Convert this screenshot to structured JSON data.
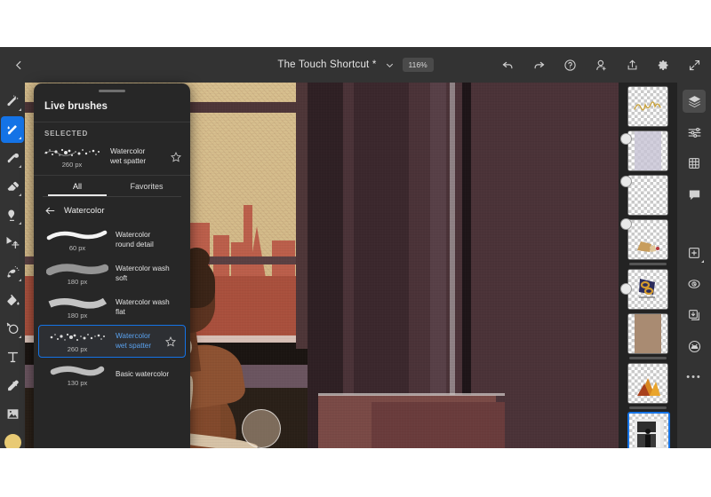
{
  "topbar": {
    "back_icon": "chevron-left-icon",
    "title": "The Touch Shortcut *",
    "title_chevron": "chevron-down-icon",
    "zoom": "116%",
    "actions": [
      {
        "name": "undo-button",
        "icon": "undo-icon"
      },
      {
        "name": "redo-button",
        "icon": "redo-icon"
      },
      {
        "name": "help-button",
        "icon": "question-circle-icon"
      },
      {
        "name": "invite-button",
        "icon": "add-person-icon"
      },
      {
        "name": "share-button",
        "icon": "share-upload-icon"
      },
      {
        "name": "settings-button",
        "icon": "gear-icon"
      },
      {
        "name": "fullscreen-button",
        "icon": "expand-arrows-icon"
      }
    ]
  },
  "left_tools": [
    {
      "name": "tool-pixel-brush",
      "icon": "pixel-brush-icon",
      "selected": false,
      "corner": true
    },
    {
      "name": "tool-live-brush",
      "icon": "live-brush-icon",
      "selected": true,
      "corner": true
    },
    {
      "name": "tool-smudge",
      "icon": "smudge-brush-icon",
      "selected": false,
      "corner": true
    },
    {
      "name": "tool-eraser",
      "icon": "eraser-icon",
      "selected": false,
      "corner": true
    },
    {
      "name": "tool-blend",
      "icon": "blend-thumb-icon",
      "selected": false,
      "corner": true
    },
    {
      "name": "tool-transform",
      "icon": "move-transform-icon",
      "selected": false,
      "corner": false
    },
    {
      "name": "tool-selection",
      "icon": "magic-wand-select-icon",
      "selected": false,
      "corner": true
    },
    {
      "name": "tool-fill",
      "icon": "paint-bucket-icon",
      "selected": false,
      "corner": false
    },
    {
      "name": "tool-shapes",
      "icon": "shape-lasso-icon",
      "selected": false,
      "corner": true
    },
    {
      "name": "tool-text",
      "icon": "text-icon",
      "selected": false,
      "corner": false
    },
    {
      "name": "tool-eyedropper",
      "icon": "eyedropper-icon",
      "selected": false,
      "corner": false
    },
    {
      "name": "tool-place-image",
      "icon": "image-icon",
      "selected": false,
      "corner": false
    }
  ],
  "color_swatch": "#e8ca74",
  "panel": {
    "title": "Live brushes",
    "selected_header": "SELECTED",
    "selected_brush": {
      "name": "Watercolor\nwet spatter",
      "name_line1": "Watercolor",
      "name_line2": "wet spatter",
      "size": "260 px",
      "favorite_icon": "star-outline-icon"
    },
    "tabs": [
      {
        "label": "All",
        "active": true
      },
      {
        "label": "Favorites",
        "active": false
      }
    ],
    "breadcrumb": {
      "back_icon": "arrow-left-icon",
      "label": "Watercolor"
    },
    "brushes": [
      {
        "line1": "Watercolor",
        "line2": "round detail",
        "size": "60 px",
        "selected": false,
        "stroke": "round-detail",
        "star": false
      },
      {
        "line1": "Watercolor wash soft",
        "line2": "",
        "size": "180 px",
        "selected": false,
        "stroke": "wash-soft",
        "star": false
      },
      {
        "line1": "Watercolor wash flat",
        "line2": "",
        "size": "180 px",
        "selected": false,
        "stroke": "wash-flat",
        "star": false
      },
      {
        "line1": "Watercolor",
        "line2": "wet spatter",
        "size": "260 px",
        "selected": true,
        "stroke": "spatter",
        "star": true
      },
      {
        "line1": "Basic watercolor",
        "line2": "",
        "size": "130 px",
        "selected": false,
        "stroke": "basic",
        "star": false
      }
    ]
  },
  "layers": [
    {
      "name": "layer-thumb-1",
      "badge": "gray",
      "content": "script-signature"
    },
    {
      "name": "layer-thumb-2",
      "badge": "gray",
      "content": "lavender-block"
    },
    {
      "name": "layer-thumb-3",
      "badge": "gray",
      "content": "empty"
    },
    {
      "name": "layer-thumb-4",
      "badge": "none",
      "content": "book-sketch"
    },
    {
      "name": "layer-thumb-5",
      "badge": "gray",
      "content": "head-wrap"
    },
    {
      "name": "layer-thumb-6",
      "badge": "none",
      "content": "tan-fill"
    },
    {
      "name": "layer-thumb-7",
      "badge": "none",
      "content": "orange-figure"
    },
    {
      "name": "layer-thumb-8",
      "badge": "blue",
      "content": "bw-reference",
      "selected": true
    }
  ],
  "right_tools": [
    {
      "name": "panel-layers",
      "icon": "layers-stack-icon",
      "active": true,
      "corner": false
    },
    {
      "name": "panel-adjustments",
      "icon": "sliders-icon",
      "active": false,
      "corner": false
    },
    {
      "name": "panel-grid",
      "icon": "grid-icon",
      "active": false,
      "corner": false
    },
    {
      "name": "panel-comments",
      "icon": "comment-bubble-icon",
      "active": false,
      "corner": false
    },
    {
      "name": "add-layer-button",
      "icon": "add-square-icon",
      "active": false,
      "corner": true
    },
    {
      "name": "layer-visibility-button",
      "icon": "eye-clock-icon",
      "active": false,
      "corner": false
    },
    {
      "name": "merge-down-button",
      "icon": "merge-down-icon",
      "active": false,
      "corner": false
    },
    {
      "name": "mask-button",
      "icon": "mask-circle-icon",
      "active": false,
      "corner": false
    },
    {
      "name": "more-options-button",
      "icon": "more-dots-icon",
      "active": false,
      "corner": false
    }
  ],
  "canvas": {
    "brush_cursor": "brush-cursor-ring"
  }
}
